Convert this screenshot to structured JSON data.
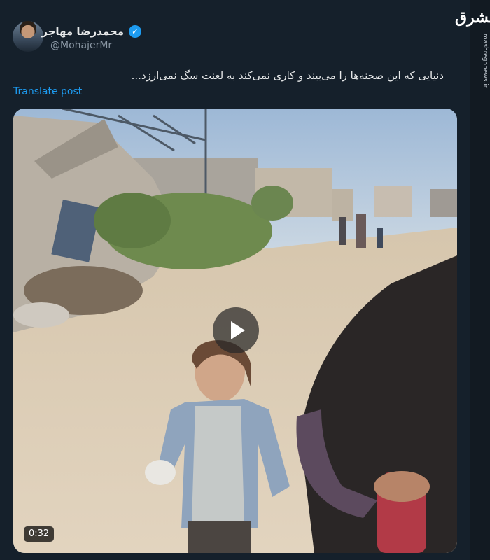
{
  "post": {
    "author": {
      "display_name": "محمدرضا مهاجر",
      "handle": "@MohajerMr",
      "verified": true
    },
    "text": "دنیایی که این صحنه‌ها را می‌بیند و کاری نمی‌کند به لعنت سگ نمی‌ارزد...",
    "translate_label": "Translate post",
    "media": {
      "type": "video",
      "duration": "0:32"
    }
  },
  "watermark": {
    "logo": "مشرق",
    "url": "mashreghnews.ir"
  },
  "colors": {
    "background": "#15202b",
    "accent": "#1d9bf0",
    "text": "#e7e9ea",
    "secondary_text": "#8b98a5"
  },
  "icons": [
    "verified-badge-icon",
    "play-icon"
  ]
}
